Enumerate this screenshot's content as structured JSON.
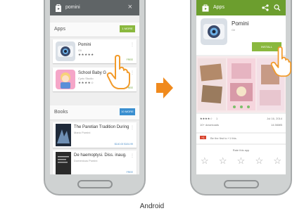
{
  "left": {
    "search_query": "pomini",
    "apps_section": {
      "title": "Apps",
      "more_label": "1 MORE"
    },
    "apps": [
      {
        "name": "Pomini",
        "developer": "Gli",
        "stars": "★★★★★",
        "price": "FREE"
      },
      {
        "name": "School Baby G",
        "developer": "Cyric Studio",
        "stars": "★★★★☆",
        "price": "FREE"
      }
    ],
    "books_section": {
      "title": "Books",
      "more_label": "10 MORE"
    },
    "books": [
      {
        "title": "The Paretian Tradition During",
        "author": "Mario Pomini",
        "price": "$140.00 $104.99"
      },
      {
        "title": "De haemoptysi. Diss. inaug.",
        "author": "Domenicus Pomini",
        "price": "FREE"
      }
    ]
  },
  "right": {
    "appbar_title": "Apps",
    "app_name": "Pomini",
    "app_developer": "Gli",
    "install_label": "INSTALL",
    "rating_stars": "★★★★☆",
    "rating_count": "1",
    "downloads": "10+ downloads",
    "date": "Jul 16, 2014",
    "size": "14.56MB",
    "plusone_badge": "+1",
    "plusone_text": "Be the first to +1 this.",
    "rate_title": "Rate this app",
    "rate_stars": [
      "☆",
      "☆",
      "☆",
      "☆",
      "☆"
    ]
  },
  "caption": "Android",
  "colors": {
    "play_green": "#6c9e2e",
    "install_green": "#8ab83e",
    "books_blue": "#3a8fd0",
    "arrow_orange": "#f08a1d",
    "hand_orange": "#f29b2b"
  }
}
